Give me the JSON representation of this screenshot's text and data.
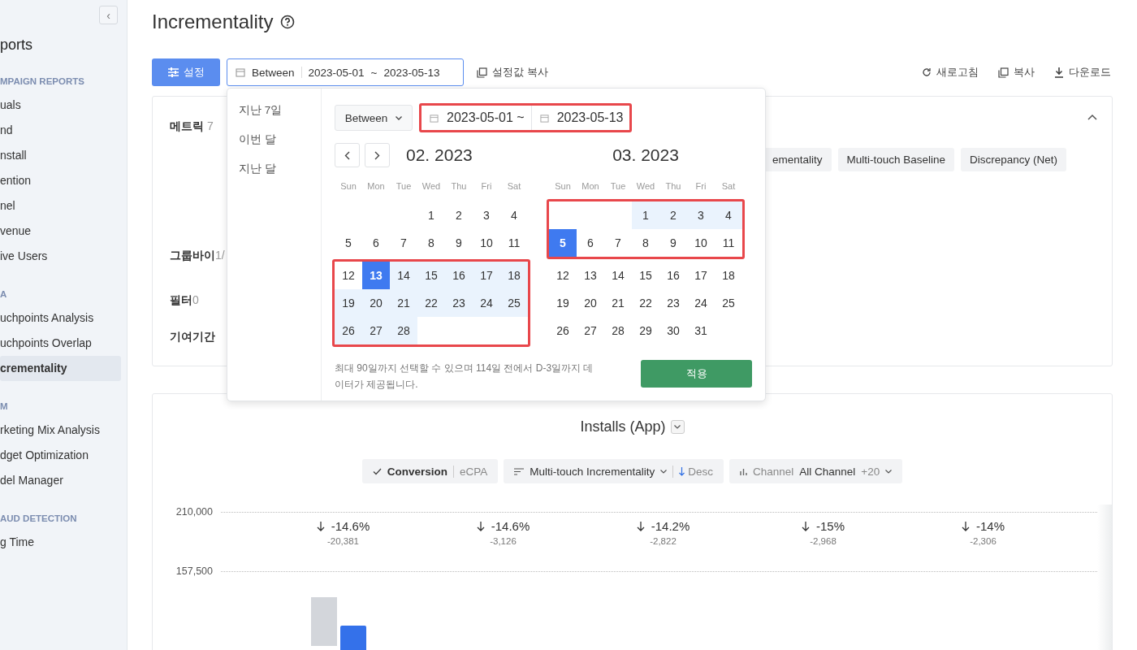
{
  "sidebar": {
    "collapse_icon": "‹",
    "title": "ports",
    "sections": [
      {
        "heading": "MPAIGN REPORTS",
        "items": [
          {
            "label": "uals",
            "selected": false
          },
          {
            "label": "nd",
            "selected": false
          },
          {
            "label": "nstall",
            "selected": false
          },
          {
            "label": "ention",
            "selected": false
          },
          {
            "label": "nel",
            "selected": false
          },
          {
            "label": "venue",
            "selected": false
          },
          {
            "label": "ive Users",
            "selected": false
          }
        ]
      },
      {
        "heading": "A",
        "items": [
          {
            "label": "uchpoints Analysis",
            "selected": false
          },
          {
            "label": "uchpoints Overlap",
            "selected": false
          },
          {
            "label": "crementality",
            "selected": true
          }
        ]
      },
      {
        "heading": "M",
        "items": [
          {
            "label": "rketing Mix Analysis",
            "selected": false
          },
          {
            "label": "dget Optimization",
            "selected": false
          },
          {
            "label": "del Manager",
            "selected": false
          }
        ]
      },
      {
        "heading": "AUD DETECTION",
        "items": [
          {
            "label": "g Time",
            "selected": false
          }
        ]
      }
    ]
  },
  "page": {
    "title": "Incrementality"
  },
  "toolbar": {
    "settings_button": "설정",
    "date_field": {
      "mode": "Between",
      "start": "2023-05-01",
      "separator": "~",
      "end": "2023-05-13"
    },
    "copy_settings": "설정값 복사",
    "actions": [
      {
        "kind": "refresh",
        "label": "새로고침"
      },
      {
        "kind": "copy",
        "label": "복사"
      },
      {
        "kind": "download",
        "label": "다운로드"
      }
    ]
  },
  "settings_card": {
    "rows": [
      {
        "label": "메트릭",
        "count": "7"
      },
      {
        "label": "그룹바이",
        "count": "1/"
      },
      {
        "label": "필터",
        "count": "0"
      },
      {
        "label": "기여기간"
      }
    ],
    "metric_chips": [
      "ementality",
      "Multi-touch Baseline",
      "Discrepancy (Net)"
    ]
  },
  "date_picker": {
    "presets": [
      {
        "label": "지난 7일",
        "selected": false
      },
      {
        "label": "이번 달",
        "selected": false
      },
      {
        "label": "지난 달",
        "selected": false
      }
    ],
    "mode": "Between",
    "inputs_highlighted": true,
    "start": "2023-05-01 ~",
    "end": "2023-05-13",
    "months": [
      {
        "title": "02. 2023",
        "weekdays": [
          "Sun",
          "Mon",
          "Tue",
          "Wed",
          "Thu",
          "Fri",
          "Sat"
        ],
        "blocks": [
          {
            "highlighted": false,
            "weeks": [
              {
                "kind": "first",
                "days": [
                  {
                    "day": "1",
                    "selected": false,
                    "in_range": false
                  },
                  {
                    "day": "2",
                    "selected": false,
                    "in_range": false
                  },
                  {
                    "day": "3",
                    "selected": false,
                    "in_range": false
                  },
                  {
                    "day": "4",
                    "selected": false,
                    "in_range": false
                  }
                ]
              },
              {
                "kind": "week",
                "days": [
                  {
                    "day": "5",
                    "selected": false,
                    "in_range": false
                  },
                  {
                    "day": "6",
                    "selected": false,
                    "in_range": false
                  },
                  {
                    "day": "7",
                    "selected": false,
                    "in_range": false
                  },
                  {
                    "day": "8",
                    "selected": false,
                    "in_range": false
                  },
                  {
                    "day": "9",
                    "selected": false,
                    "in_range": false
                  },
                  {
                    "day": "10",
                    "selected": false,
                    "in_range": false
                  },
                  {
                    "day": "11",
                    "selected": false,
                    "in_range": false
                  }
                ]
              }
            ]
          },
          {
            "highlighted": true,
            "weeks": [
              {
                "kind": "week",
                "days": [
                  {
                    "day": "12",
                    "selected": false,
                    "in_range": false
                  },
                  {
                    "day": "13",
                    "selected": true,
                    "in_range": false
                  },
                  {
                    "day": "14",
                    "selected": false,
                    "in_range": true
                  },
                  {
                    "day": "15",
                    "selected": false,
                    "in_range": true
                  },
                  {
                    "day": "16",
                    "selected": false,
                    "in_range": true
                  },
                  {
                    "day": "17",
                    "selected": false,
                    "in_range": true
                  },
                  {
                    "day": "18",
                    "selected": false,
                    "in_range": true
                  }
                ]
              },
              {
                "kind": "week",
                "days": [
                  {
                    "day": "19",
                    "selected": false,
                    "in_range": true
                  },
                  {
                    "day": "20",
                    "selected": false,
                    "in_range": true
                  },
                  {
                    "day": "21",
                    "selected": false,
                    "in_range": true
                  },
                  {
                    "day": "22",
                    "selected": false,
                    "in_range": true
                  },
                  {
                    "day": "23",
                    "selected": false,
                    "in_range": true
                  },
                  {
                    "day": "24",
                    "selected": false,
                    "in_range": true
                  },
                  {
                    "day": "25",
                    "selected": false,
                    "in_range": true
                  }
                ]
              },
              {
                "kind": "week",
                "days": [
                  {
                    "day": "26",
                    "selected": false,
                    "in_range": true
                  },
                  {
                    "day": "27",
                    "selected": false,
                    "in_range": true
                  },
                  {
                    "day": "28",
                    "selected": false,
                    "in_range": true
                  }
                ]
              }
            ]
          }
        ]
      },
      {
        "title": "03. 2023",
        "weekdays": [
          "Sun",
          "Mon",
          "Tue",
          "Wed",
          "Thu",
          "Fri",
          "Sat"
        ],
        "blocks": [
          {
            "highlighted": true,
            "weeks": [
              {
                "kind": "first",
                "days": [
                  {
                    "day": "1",
                    "selected": false,
                    "in_range": true
                  },
                  {
                    "day": "2",
                    "selected": false,
                    "in_range": true
                  },
                  {
                    "day": "3",
                    "selected": false,
                    "in_range": true
                  },
                  {
                    "day": "4",
                    "selected": false,
                    "in_range": true
                  }
                ]
              },
              {
                "kind": "week",
                "days": [
                  {
                    "day": "5",
                    "selected": true,
                    "in_range": false
                  },
                  {
                    "day": "6",
                    "selected": false,
                    "in_range": false
                  },
                  {
                    "day": "7",
                    "selected": false,
                    "in_range": false
                  },
                  {
                    "day": "8",
                    "selected": false,
                    "in_range": false
                  },
                  {
                    "day": "9",
                    "selected": false,
                    "in_range": false
                  },
                  {
                    "day": "10",
                    "selected": false,
                    "in_range": false
                  },
                  {
                    "day": "11",
                    "selected": false,
                    "in_range": false
                  }
                ]
              }
            ]
          },
          {
            "highlighted": false,
            "weeks": [
              {
                "kind": "week",
                "days": [
                  {
                    "day": "12",
                    "selected": false,
                    "in_range": false
                  },
                  {
                    "day": "13",
                    "selected": false,
                    "in_range": false
                  },
                  {
                    "day": "14",
                    "selected": false,
                    "in_range": false
                  },
                  {
                    "day": "15",
                    "selected": false,
                    "in_range": false
                  },
                  {
                    "day": "16",
                    "selected": false,
                    "in_range": false
                  },
                  {
                    "day": "17",
                    "selected": false,
                    "in_range": false
                  },
                  {
                    "day": "18",
                    "selected": false,
                    "in_range": false
                  }
                ]
              },
              {
                "kind": "week",
                "days": [
                  {
                    "day": "19",
                    "selected": false,
                    "in_range": false
                  },
                  {
                    "day": "20",
                    "selected": false,
                    "in_range": false
                  },
                  {
                    "day": "21",
                    "selected": false,
                    "in_range": false
                  },
                  {
                    "day": "22",
                    "selected": false,
                    "in_range": false
                  },
                  {
                    "day": "23",
                    "selected": false,
                    "in_range": false
                  },
                  {
                    "day": "24",
                    "selected": false,
                    "in_range": false
                  },
                  {
                    "day": "25",
                    "selected": false,
                    "in_range": false
                  }
                ]
              },
              {
                "kind": "week",
                "days": [
                  {
                    "day": "26",
                    "selected": false,
                    "in_range": false
                  },
                  {
                    "day": "27",
                    "selected": false,
                    "in_range": false
                  },
                  {
                    "day": "28",
                    "selected": false,
                    "in_range": false
                  },
                  {
                    "day": "29",
                    "selected": false,
                    "in_range": false
                  },
                  {
                    "day": "30",
                    "selected": false,
                    "in_range": false
                  },
                  {
                    "day": "31",
                    "selected": false,
                    "in_range": false
                  }
                ]
              }
            ]
          }
        ]
      }
    ],
    "note": "최대 90일까지 선택할 수 있으며 114일 전에서 D-3일까지 데이터가 제공됩니다.",
    "apply_button": "적용"
  },
  "chart_card": {
    "title": "Installs (App)",
    "controls": {
      "conversion": "Conversion",
      "ecpa": "eCPA",
      "sort_metric": "Multi-touch Incrementality",
      "order": "Desc",
      "group_label": "Channel",
      "group_value": "All Channel",
      "group_extra": "+20"
    },
    "y_ticks": [
      "210,000",
      "157,500"
    ],
    "deltas": [
      {
        "change": "-14.6%",
        "diff": "-20,381"
      },
      {
        "change": "-14.6%",
        "diff": "-3,126"
      },
      {
        "change": "-14.2%",
        "diff": "-2,822"
      },
      {
        "change": "-15%",
        "diff": "-2,968"
      },
      {
        "change": "-14%",
        "diff": "-2,306"
      }
    ]
  }
}
